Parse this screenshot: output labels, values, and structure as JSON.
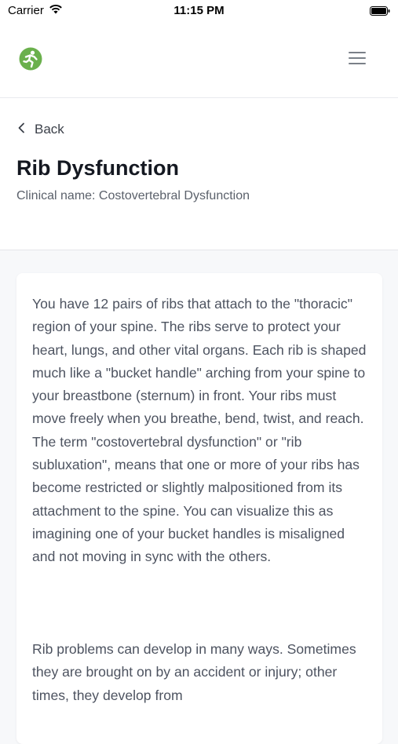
{
  "status_bar": {
    "carrier": "Carrier",
    "time": "11:15 PM"
  },
  "header": {
    "logo_icon": "runner-logo-icon",
    "menu_icon": "hamburger-menu-icon",
    "brand_color": "#6ab04c"
  },
  "page": {
    "back_label": "Back",
    "title": "Rib Dysfunction",
    "subtitle": "Clinical name: Costovertebral Dysfunction"
  },
  "content": {
    "paragraph_1": "You have 12 pairs of ribs that attach to the \"thoracic\" region of your spine. The ribs serve to protect your heart, lungs, and other vital organs. Each rib is shaped much like a \"bucket handle\" arching from your spine to your breastbone (sternum) in front. Your ribs must move freely when you breathe, bend, twist, and reach. The term \"costovertebral dysfunction\" or \"rib subluxation\", means that one or more of your ribs has become restricted or slightly malpositioned from its attachment to the spine. You can visualize this as imagining one of your bucket handles is misaligned and not moving in sync with the others.",
    "paragraph_2": "Rib problems can develop in many ways. Sometimes they are brought on by an accident or injury; other times, they develop from"
  }
}
